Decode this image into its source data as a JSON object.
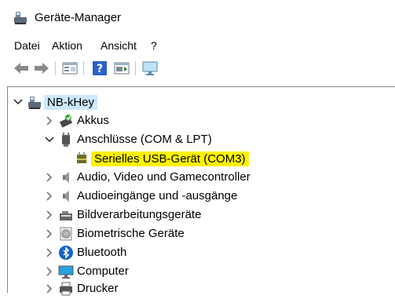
{
  "window": {
    "title": "Geräte-Manager",
    "icon": "device-manager-icon"
  },
  "menu": {
    "items": [
      "Datei",
      "Aktion",
      "Ansicht",
      "?"
    ]
  },
  "toolbar": {
    "buttons": [
      "back-arrow-icon",
      "forward-arrow-icon",
      "properties-icon",
      "help-icon",
      "update-driver-icon",
      "monitor-icon"
    ]
  },
  "tree": {
    "root": {
      "label": "NB-kHey",
      "state": "expanded"
    },
    "items": [
      {
        "label": "Akkus",
        "state": "collapsed",
        "icon": "battery-icon"
      },
      {
        "label": "Anschlüsse (COM & LPT)",
        "state": "expanded",
        "icon": "port-icon"
      },
      {
        "label": "Serielles USB-Gerät (COM3)",
        "state": "leaf",
        "icon": "usb-serial-icon",
        "highlight": "#fff200"
      },
      {
        "label": "Audio, Video und Gamecontroller",
        "state": "collapsed",
        "icon": "speaker-icon"
      },
      {
        "label": "Audioeingänge und -ausgänge",
        "state": "collapsed",
        "icon": "speaker-icon"
      },
      {
        "label": "Bildverarbeitungsgeräte",
        "state": "collapsed",
        "icon": "camera-icon"
      },
      {
        "label": "Biometrische Geräte",
        "state": "collapsed",
        "icon": "fingerprint-icon"
      },
      {
        "label": "Bluetooth",
        "state": "collapsed",
        "icon": "bluetooth-icon"
      },
      {
        "label": "Computer",
        "state": "collapsed",
        "icon": "computer-icon"
      },
      {
        "label": "Drucker",
        "state": "collapsed",
        "icon": "printer-icon"
      }
    ]
  }
}
